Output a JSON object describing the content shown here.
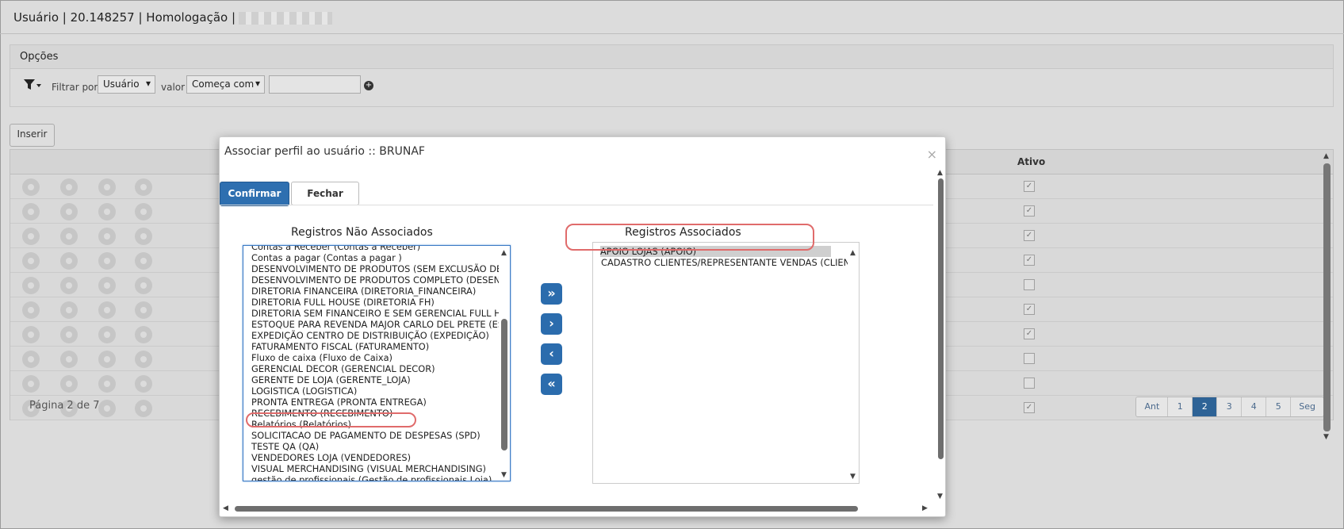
{
  "header": {
    "title": "Usuário | 20.148257 | Homologação |"
  },
  "options": {
    "title": "Opções",
    "filter_by_label": "Filtrar por",
    "filter_field": "Usuário",
    "value_label": "valor",
    "match_mode": "Começa com",
    "search_value": ""
  },
  "actions": {
    "insert_label": "Inserir"
  },
  "grid": {
    "active_header": "Ativo",
    "rows": [
      {
        "ativo": true
      },
      {
        "ativo": true
      },
      {
        "ativo": true
      },
      {
        "ativo": true
      },
      {
        "ativo": false
      },
      {
        "ativo": true
      },
      {
        "ativo": true
      },
      {
        "ativo": false
      },
      {
        "ativo": false
      },
      {
        "ativo": true
      }
    ],
    "page_info": "Página 2 de 7",
    "pager": [
      "Ant",
      "1",
      "2",
      "3",
      "4",
      "5",
      "Seg"
    ],
    "current_page": "2"
  },
  "modal": {
    "title": "Associar perfil ao usuário :: BRUNAF",
    "confirm_label": "Confirmar",
    "close_label": "Fechar",
    "left_header": "Registros Não Associados",
    "right_header": "Registros Associados",
    "left_items": [
      "Contas a Receber (Contas a Receber)",
      "Contas a pagar (Contas a pagar )",
      "DESENVOLVIMENTO DE PRODUTOS (SEM EXCLUSÃO DE (",
      "DESENVOLVIMENTO DE PRODUTOS COMPLETO (DESENVO",
      "DIRETORIA FINANCEIRA (DIRETORIA_FINANCEIRA)",
      "DIRETORIA FULL HOUSE (DIRETORIA FH)",
      "DIRETORIA SEM FINANCEIRO E SEM GERENCIAL FULL HO",
      "ESTOQUE PARA REVENDA MAJOR CARLO DEL PRETE (EST",
      "EXPEDIÇÃO CENTRO DE DISTRIBUIÇÃO (EXPEDIÇÃO)",
      "FATURAMENTO FISCAL (FATURAMENTO)",
      "Fluxo de caixa (Fluxo de Caixa)",
      "GERENCIAL DECOR (GERENCIAL DECOR)",
      "GERENTE DE LOJA (GERENTE_LOJA)",
      "LOGISTICA (LOGISTICA)",
      "PRONTA ENTREGA (PRONTA ENTREGA)",
      "RECEBIMENTO (RECEBIMENTO)",
      "Relatórios (Relatórios)",
      "SOLICITACAO DE PAGAMENTO DE DESPESAS (SPD)",
      "TESTE QA (QA)",
      "VENDEDORES LOJA (VENDEDORES)",
      "VISUAL MERCHANDISING (VISUAL MERCHANDISING)",
      "gestão de profissionais (Gestão de profissionais Loja)"
    ],
    "right_items": [
      "APOIO LOJAS (APOIO)",
      "CADASTRO CLIENTES/REPRESENTANTE VENDAS (CLIENT"
    ],
    "move_buttons": [
      "»",
      "›",
      "‹",
      "«"
    ]
  }
}
